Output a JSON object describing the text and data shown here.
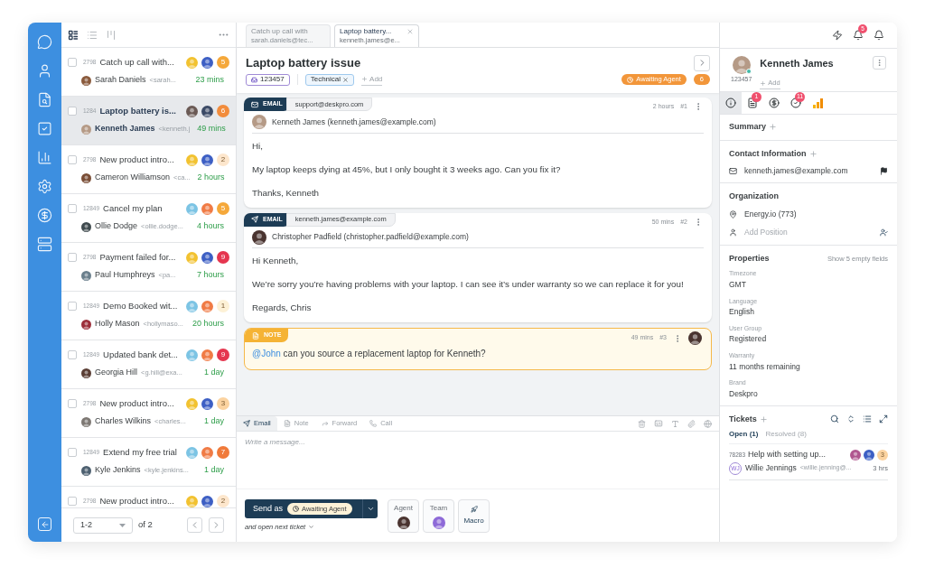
{
  "list_views": [
    {
      "kind": "compact",
      "selected": true
    },
    {
      "kind": "list",
      "selected": false
    },
    {
      "kind": "board",
      "selected": false
    }
  ],
  "tickets": [
    {
      "id": "2798",
      "subject": "Catch up call with...",
      "requester": "Sarah Daniels",
      "email": "<sarah...",
      "time": "23 mins",
      "count": "5",
      "color": "#f5a83a",
      "selected": false,
      "avatars": [
        {
          "color": "#f2c230"
        },
        {
          "color": "#3d5fc4"
        }
      ],
      "requester_avatar": {
        "color": "#8a5a3c"
      }
    },
    {
      "id": "1284",
      "subject": "Laptop battery is...",
      "requester": "Kenneth James",
      "email": "<kenneth.j",
      "time": "49 mins",
      "count": "6",
      "color": "#f28c3c",
      "selected": true,
      "avatars": [
        {
          "color": "#6b5a55"
        },
        {
          "color": "#3b4a66"
        }
      ],
      "requester_avatar": {
        "color": "#b59a86"
      }
    },
    {
      "id": "2798",
      "subject": "New product intro...",
      "requester": "Cameron Williamson",
      "email": "<ca...",
      "time": "2 hours",
      "count": "2",
      "color": "#fde6cc",
      "selected": false,
      "avatars": [
        {
          "color": "#f2c230"
        },
        {
          "color": "#3d5fc4"
        }
      ],
      "requester_avatar": {
        "color": "#7a4e36"
      }
    },
    {
      "id": "12849",
      "subject": "Cancel my plan",
      "requester": "Ollie Dodge",
      "email": "<ollie.dodge...",
      "time": "4 hours",
      "count": "5",
      "color": "#f5a83a",
      "selected": false,
      "avatars": [
        {
          "color": "#7cc4e4"
        },
        {
          "color": "#f07b45"
        }
      ],
      "requester_avatar": {
        "color": "#3f4a4e"
      }
    },
    {
      "id": "2798",
      "subject": "Payment failed for...",
      "requester": "Paul Humphreys",
      "email": "<pa...",
      "time": "7 hours",
      "count": "9",
      "color": "#e5364f",
      "selected": false,
      "avatars": [
        {
          "color": "#f2c230"
        },
        {
          "color": "#3d5fc4"
        }
      ],
      "requester_avatar": {
        "color": "#6a7f8c"
      }
    },
    {
      "id": "12849",
      "subject": "Demo Booked wit...",
      "requester": "Holly Mason",
      "email": "<hollymaso...",
      "time": "20 hours",
      "count": "1",
      "color": "#fdf1d6",
      "selected": false,
      "avatars": [
        {
          "color": "#7cc4e4"
        },
        {
          "color": "#f07b45"
        }
      ],
      "requester_avatar": {
        "color": "#9c2f3a"
      }
    },
    {
      "id": "12849",
      "subject": "Updated bank det...",
      "requester": "Georgia Hill",
      "email": "<g.hill@exa...",
      "time": "1 day",
      "count": "9",
      "color": "#e5364f",
      "selected": false,
      "avatars": [
        {
          "color": "#7cc4e4"
        },
        {
          "color": "#f07b45"
        }
      ],
      "requester_avatar": {
        "color": "#5a3e34"
      }
    },
    {
      "id": "2798",
      "subject": "New product intro...",
      "requester": "Charles Wilkins",
      "email": "<charles...",
      "time": "1 day",
      "count": "3",
      "color": "#fbd3a0",
      "selected": false,
      "avatars": [
        {
          "color": "#f2c230"
        },
        {
          "color": "#3d5fc4"
        }
      ],
      "requester_avatar": {
        "color": "#7d7873"
      }
    },
    {
      "id": "12849",
      "subject": "Extend my free trial",
      "requester": "Kyle Jenkins",
      "email": "<kyle.jenkins...",
      "time": "1 day",
      "count": "7",
      "color": "#f07a3a",
      "selected": false,
      "avatars": [
        {
          "color": "#7cc4e4"
        },
        {
          "color": "#f07b45"
        }
      ],
      "requester_avatar": {
        "color": "#4d6070"
      }
    },
    {
      "id": "2798",
      "subject": "New product intro...",
      "count": "2",
      "color": "#fde6cc",
      "selected": false,
      "avatars": [
        {
          "color": "#f2c230"
        },
        {
          "color": "#3d5fc4"
        }
      ]
    }
  ],
  "pager": {
    "value": "1-2",
    "total": "of 2"
  },
  "tabs": [
    {
      "title": "Catch up call with",
      "subtitle": "sarah.daniels@tec...",
      "selected": false
    },
    {
      "title": "Laptop battery...",
      "subtitle": "kenneth.james@e...",
      "selected": true
    }
  ],
  "ticket": {
    "title": "Laptop battery issue",
    "id": "123457",
    "tags": [
      {
        "label": "Technical"
      }
    ],
    "add": "Add",
    "status": "Awaiting Agent",
    "count": "6"
  },
  "messages": [
    {
      "kind": "inbound_email",
      "label": "EMAIL",
      "address": "support@deskpro.com",
      "time": "2 hours",
      "number": "#1",
      "author": "Kenneth James (kenneth.james@example.com)",
      "avatar": {
        "color": "#b59a86"
      },
      "body": [
        "Hi,",
        "My laptop keeps dying at 45%, but I only bought it 3 weeks ago. Can you fix it?",
        "Thanks, Kenneth"
      ]
    },
    {
      "kind": "outbound_email",
      "label": "EMAIL",
      "address": "kenneth.james@example.com",
      "time": "50 mins",
      "number": "#2",
      "author": "Christopher Padfield (christopher.padfield@example.com)",
      "avatar": {
        "color": "#4a3430"
      },
      "body": [
        "Hi Kenneth,",
        "We’re sorry you’re having problems with your laptop. I can see it’s under warranty so we can replace it for you!",
        "Regards, Chris"
      ]
    },
    {
      "kind": "note",
      "label": "NOTE",
      "time": "49 mins",
      "number": "#3",
      "avatar": {
        "color": "#4a3430"
      },
      "mention": "@John",
      "text": " can you source a replacement laptop for Kenneth?"
    }
  ],
  "composer": {
    "modes": [
      {
        "kind": "email",
        "label": "Email",
        "selected": true
      },
      {
        "kind": "note",
        "label": "Note",
        "selected": false
      },
      {
        "kind": "forward",
        "label": "Forward",
        "selected": false
      },
      {
        "kind": "call",
        "label": "Call",
        "selected": false
      }
    ],
    "placeholder": "Write a message...",
    "send_label": "Send as",
    "send_status": "Awaiting Agent",
    "next": "and open next ticket",
    "assign": [
      {
        "kind": "agent",
        "label": "Agent",
        "avatar": {
          "color": "#4a3430"
        }
      },
      {
        "kind": "team",
        "label": "Team",
        "avatar": {
          "color": "#8e6ad8"
        }
      },
      {
        "kind": "macro",
        "label": "Macro"
      }
    ]
  },
  "notifications": {
    "count": "5"
  },
  "contact": {
    "name": "Kenneth James",
    "id": "123457",
    "online": true,
    "add": "Add",
    "avatar": {
      "color": "#b59a86"
    },
    "tabs": [
      {
        "kind": "info",
        "selected": true
      },
      {
        "kind": "notes",
        "badge": "1",
        "selected": false
      },
      {
        "kind": "billing",
        "selected": false
      },
      {
        "kind": "tasks",
        "badge": "11",
        "selected": false
      },
      {
        "kind": "analytics",
        "selected": false
      }
    ],
    "summary": "Summary",
    "contact_heading": "Contact Information",
    "email": "kenneth.james@example.com",
    "org_heading": "Organization",
    "organization": "Energy.io (773)",
    "position_placeholder": "Add Position",
    "properties_heading": "Properties",
    "show_empty": "Show 5 empty fields",
    "properties": [
      {
        "label": "Timezone",
        "value": "GMT"
      },
      {
        "label": "Language",
        "value": "English"
      },
      {
        "label": "User Group",
        "value": "Registered"
      },
      {
        "label": "Warranty",
        "value": "11 months remaining"
      },
      {
        "label": "Brand",
        "value": "Deskpro"
      }
    ],
    "tickets_heading": "Tickets",
    "ticket_tabs": [
      {
        "label": "Open (1)",
        "selected": true
      },
      {
        "label": "Resolved (8)",
        "selected": false
      }
    ],
    "tickets": [
      {
        "id": "78283",
        "subject": "Help with setting up...",
        "requester": "Willie Jennings",
        "initials": "WJ",
        "email": "<willie.jenning@...",
        "time": "3 hrs",
        "count": "3",
        "color": "#fbd3a0",
        "avatars": [
          {
            "color": "#b0568f"
          },
          {
            "color": "#3d5fc4"
          }
        ]
      }
    ]
  }
}
